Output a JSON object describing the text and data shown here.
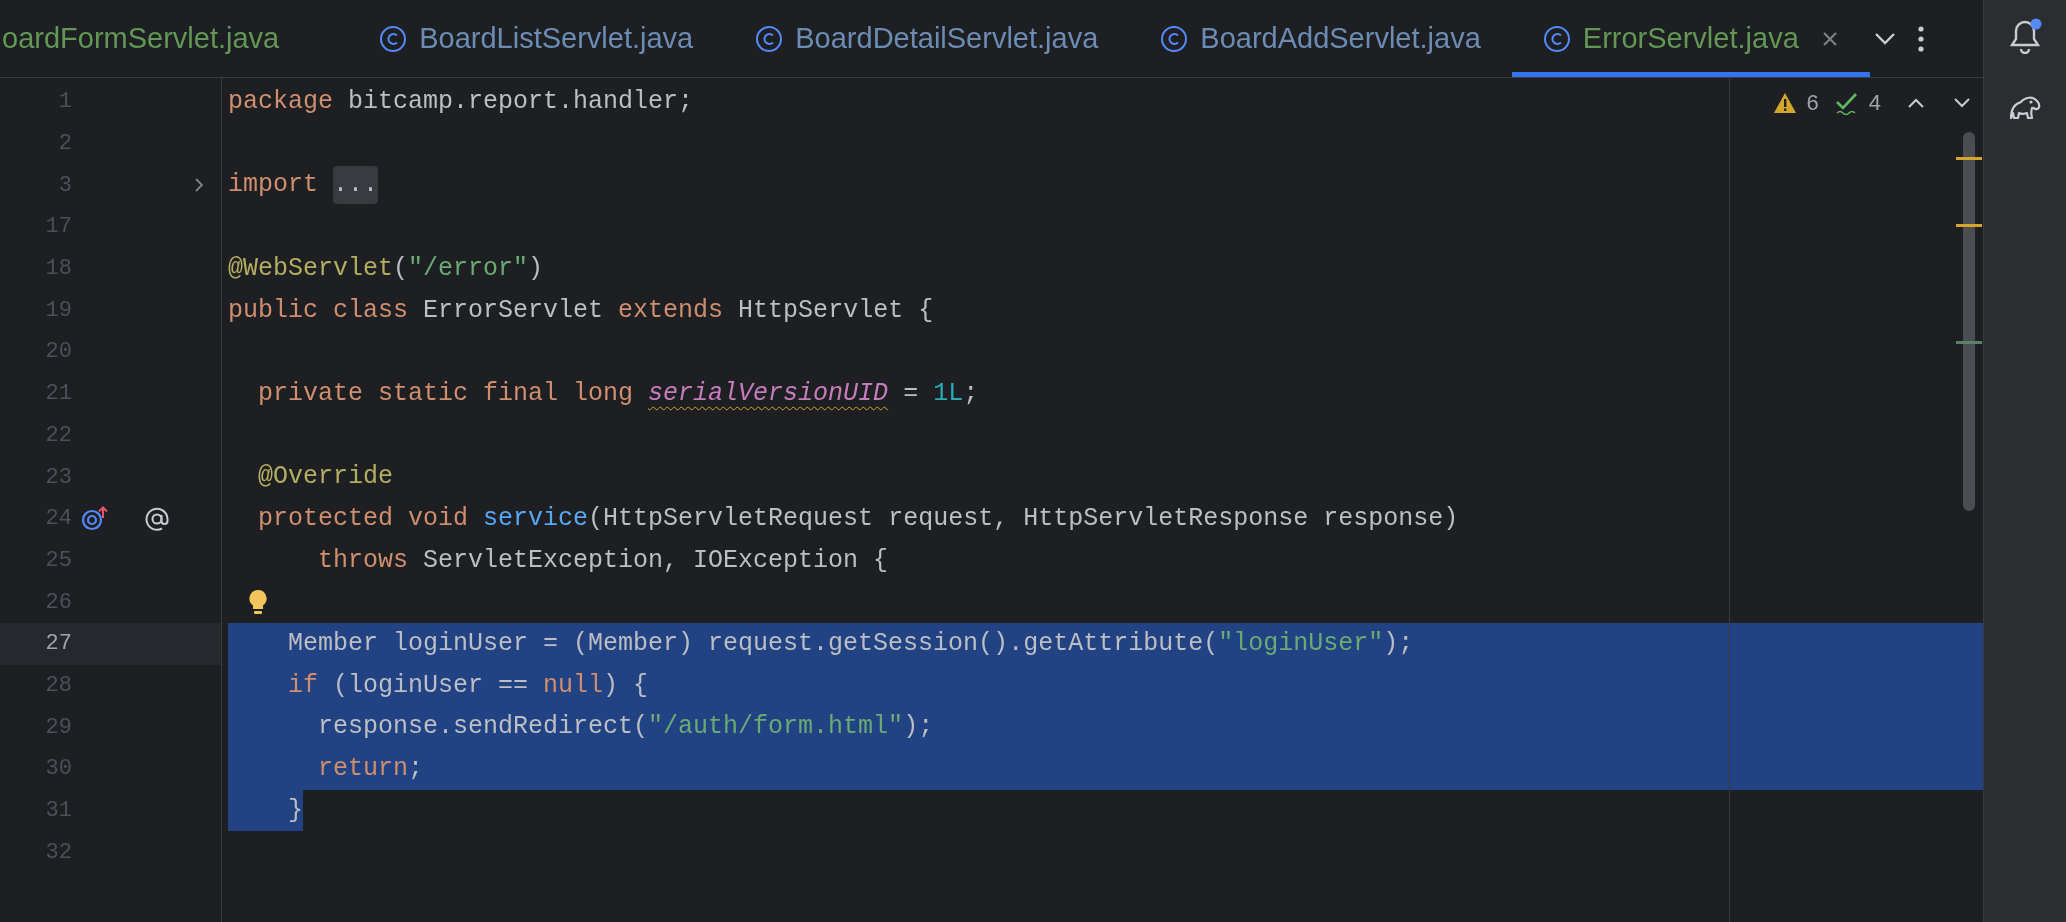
{
  "tabs": [
    {
      "label": "oardFormServlet.java",
      "icon_visible": false,
      "color": "#629755",
      "selected": false
    },
    {
      "label": "BoardListServlet.java",
      "icon_visible": true,
      "color": "#6c8cb5",
      "selected": false
    },
    {
      "label": "BoardDetailServlet.java",
      "icon_visible": true,
      "color": "#6c8cb5",
      "selected": false
    },
    {
      "label": "BoardAddServlet.java",
      "icon_visible": true,
      "color": "#6c8cb5",
      "selected": false
    },
    {
      "label": "ErrorServlet.java",
      "icon_visible": true,
      "color": "#629755",
      "selected": true
    }
  ],
  "inspections": {
    "warnings": "6",
    "weak_warnings": "4"
  },
  "notifications": {
    "unread": true
  },
  "lines": [
    {
      "number": "1",
      "current": false,
      "selected": false,
      "tokens": [
        {
          "kind": "keyword",
          "text": "package"
        },
        {
          "kind": "plain",
          "text": " bitcamp.report.handler;"
        }
      ]
    },
    {
      "number": "2",
      "current": false,
      "selected": false
    },
    {
      "number": "3",
      "current": false,
      "selected": false,
      "foldable": true,
      "tokens": [
        {
          "kind": "keyword",
          "text": "import"
        },
        {
          "kind": "fold",
          "text": "..."
        }
      ]
    },
    {
      "number": "17",
      "current": false,
      "selected": false
    },
    {
      "number": "18",
      "current": false,
      "selected": false,
      "tokens": [
        {
          "kind": "annotation",
          "text": "@WebServlet"
        },
        {
          "kind": "plain",
          "text": "("
        },
        {
          "kind": "string",
          "text": "\"/error\""
        },
        {
          "kind": "plain",
          "text": ")"
        }
      ]
    },
    {
      "number": "19",
      "current": false,
      "selected": false,
      "tokens": [
        {
          "kind": "keyword",
          "text": "public class"
        },
        {
          "kind": "plain",
          "text": " ErrorServlet "
        },
        {
          "kind": "keyword",
          "text": "extends"
        },
        {
          "kind": "plain",
          "text": " HttpServlet {"
        }
      ]
    },
    {
      "number": "20",
      "current": false,
      "selected": false
    },
    {
      "number": "21",
      "current": false,
      "selected": false,
      "tokens": [
        {
          "kind": "keyword",
          "text": "  private static final long "
        },
        {
          "kind": "field",
          "text": "serialVersionUID",
          "warning": true
        },
        {
          "kind": "plain",
          "text": " = "
        },
        {
          "kind": "number",
          "text": "1L"
        },
        {
          "kind": "plain",
          "text": ";"
        }
      ]
    },
    {
      "number": "22",
      "current": false,
      "selected": false
    },
    {
      "number": "23",
      "current": false,
      "selected": false,
      "tokens": [
        {
          "kind": "annotation",
          "text": "  @Override"
        }
      ]
    },
    {
      "number": "24",
      "current": false,
      "selected": false,
      "overrides": true,
      "tokens": [
        {
          "kind": "keyword",
          "text": "  protected void "
        },
        {
          "kind": "method",
          "text": "service"
        },
        {
          "kind": "plain",
          "text": "(HttpServletRequest request, HttpServletResponse response)"
        }
      ]
    },
    {
      "number": "25",
      "current": false,
      "selected": false,
      "tokens": [
        {
          "kind": "keyword",
          "text": "      throws"
        },
        {
          "kind": "plain",
          "text": " ServletException, IOException {"
        }
      ]
    },
    {
      "number": "26",
      "current": false,
      "selected": false,
      "bulb": true
    },
    {
      "number": "27",
      "current": true,
      "selected": true,
      "selection_to_edge": true,
      "tokens": [
        {
          "kind": "plain",
          "text": "    Member loginUser = (Member) request.getSession().getAttribute("
        },
        {
          "kind": "string",
          "text": "\"loginUser\""
        },
        {
          "kind": "plain",
          "text": ");"
        }
      ]
    },
    {
      "number": "28",
      "current": false,
      "selected": true,
      "selection_to_edge": true,
      "tokens": [
        {
          "kind": "keyword",
          "text": "    if"
        },
        {
          "kind": "plain",
          "text": " (loginUser == "
        },
        {
          "kind": "keyword",
          "text": "null"
        },
        {
          "kind": "plain",
          "text": ") {"
        }
      ]
    },
    {
      "number": "29",
      "current": false,
      "selected": true,
      "selection_to_edge": true,
      "tokens": [
        {
          "kind": "plain",
          "text": "      response.sendRedirect("
        },
        {
          "kind": "string",
          "text": "\"/auth/form.html\""
        },
        {
          "kind": "plain",
          "text": ");"
        }
      ]
    },
    {
      "number": "30",
      "current": false,
      "selected": true,
      "selection_to_edge": true,
      "tokens": [
        {
          "kind": "keyword",
          "text": "      return"
        },
        {
          "kind": "plain",
          "text": ";"
        }
      ]
    },
    {
      "number": "31",
      "current": false,
      "selected": true,
      "selection_to_edge": false,
      "tokens": [
        {
          "kind": "plain",
          "text": "    }"
        }
      ]
    },
    {
      "number": "32",
      "current": false,
      "selected": false
    }
  ]
}
